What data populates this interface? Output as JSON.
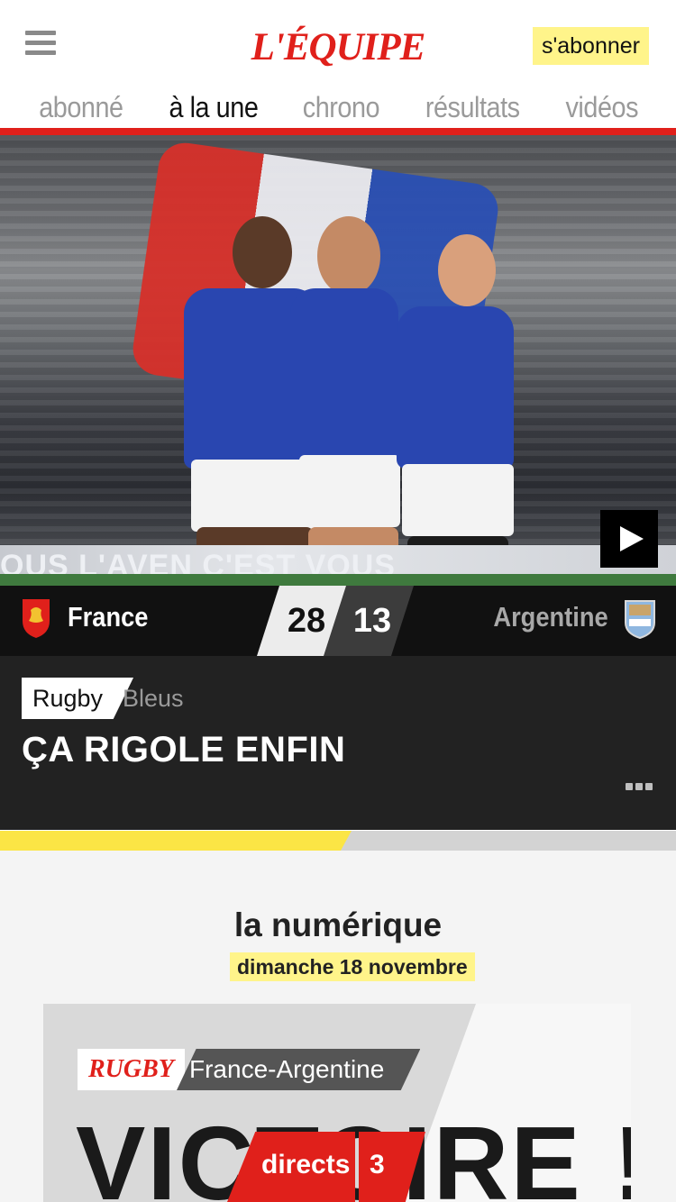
{
  "header": {
    "menu_icon": "hamburger-menu-icon",
    "logo": "L'ÉQUIPE",
    "subscribe_label": "s'abonner"
  },
  "tabs": [
    {
      "label": "abonné",
      "active": false
    },
    {
      "label": "à la une",
      "active": true
    },
    {
      "label": "chrono",
      "active": false
    },
    {
      "label": "résultats",
      "active": false
    },
    {
      "label": "vidéos",
      "active": false
    }
  ],
  "hero": {
    "banner_text": "OUS L'AVEN        C'EST VOUS",
    "play_icon": "play-icon"
  },
  "match": {
    "home_team": "France",
    "away_team": "Argentine",
    "home_score": "28",
    "away_score": "13"
  },
  "article": {
    "category": "Rugby",
    "subcategory": "Bleus",
    "headline": "ÇA RIGOLE ENFIN",
    "more_icon": "more-dots-icon"
  },
  "progress": {
    "fraction": 0.52
  },
  "promo": {
    "title": "la numérique",
    "date": "dimanche 18 novembre",
    "cover_tag": "RUGBY",
    "cover_match": "France-Argentine",
    "cover_headline": "VICTOIRE !"
  },
  "directs": {
    "label": "directs",
    "count": "3"
  },
  "colors": {
    "brand_red": "#e0201b",
    "highlight_yellow": "#fff48a",
    "jersey_blue": "#2946b0"
  }
}
